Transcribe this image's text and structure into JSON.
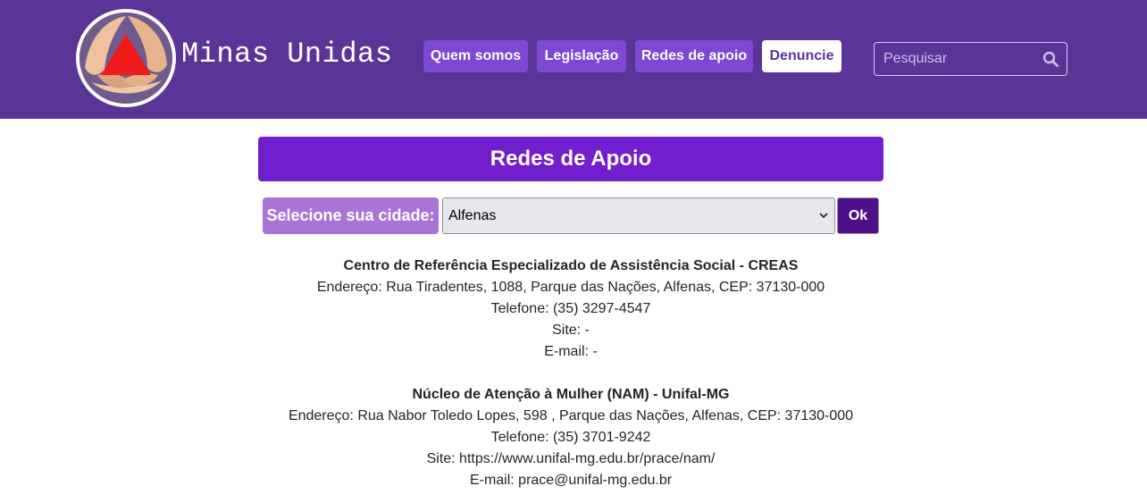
{
  "header": {
    "brand": "Minas Unidas",
    "nav": [
      "Quem somos",
      "Legislação",
      "Redes de apoio",
      "Denuncie"
    ],
    "search": {
      "placeholder": "Pesquisar",
      "icon": "search-icon"
    },
    "colors": {
      "background": "#5a3598",
      "button": "#7c48d4",
      "highlight_button": "#ffffff"
    }
  },
  "main": {
    "title": "Redes de Apoio",
    "city_label": "Selecione sua cidade:",
    "city_selected": "Alfenas",
    "ok_label": "Ok",
    "colors": {
      "title_bar": "#711ecf",
      "label": "#a874d8",
      "ok_button": "#4f0f8a"
    }
  },
  "entries": [
    {
      "name": "Centro de Referência Especializado de Assistência Social - CREAS",
      "address": "Endereço: Rua Tiradentes, 1088, Parque das Nações, Alfenas, CEP: 37130-000",
      "phone": "Telefone: (35) 3297-4547",
      "site": "Site: -",
      "email": "E-mail: -"
    },
    {
      "name": "Núcleo de Atenção à Mulher (NAM) - Unifal-MG",
      "address": "Endereço: Rua Nabor Toledo Lopes, 598 , Parque das Nações, Alfenas, CEP: 37130-000",
      "phone": "Telefone: (35) 3701-9242",
      "site": "Site: https://www.unifal-mg.edu.br/prace/nam/",
      "email": "E-mail: prace@unifal-mg.edu.br"
    }
  ]
}
